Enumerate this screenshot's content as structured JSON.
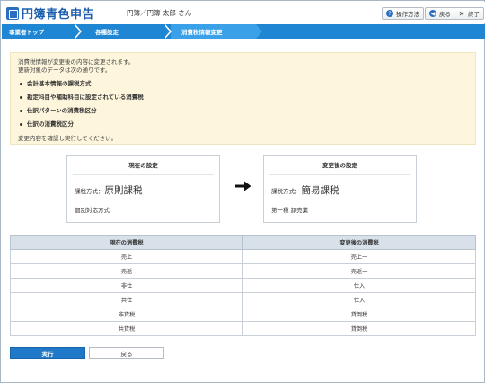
{
  "header": {
    "app_title": "円簿青色申告",
    "user_name": "円簿／円簿 太郎 さん",
    "help_label": "操作方法",
    "back_label": "戻る",
    "close_label": "終了"
  },
  "breadcrumb": {
    "items": [
      "事業者トップ",
      "各種設定",
      "消費税情報変更"
    ]
  },
  "notice": {
    "line1": "消費税情報が変更後の内容に変更されます。",
    "line2": "更新対象のデータは次の通りです。",
    "items": [
      "会計基本情報の課税方式",
      "勘定科目や補助科目に設定されている消費税",
      "仕訳パターンの消費税区分",
      "仕訳の消費税区分"
    ],
    "footer": "変更内容を確認し実行してください。"
  },
  "current": {
    "title": "現在の設定",
    "method_prefix": "課税方式：",
    "method_value": "原則課税",
    "detail": "個別対応方式"
  },
  "after": {
    "title": "変更後の設定",
    "method_prefix": "課税方式：",
    "method_value": "簡易課税",
    "detail": "第一種 卸売業"
  },
  "table": {
    "headers": [
      "現在の消費税",
      "変更後の消費税"
    ],
    "rows": [
      [
        "売上",
        "売上一"
      ],
      [
        "売返",
        "売返一"
      ],
      [
        "非仕",
        "仕入"
      ],
      [
        "共仕",
        "仕入"
      ],
      [
        "非貸税",
        "貸倒税"
      ],
      [
        "共貸税",
        "貸倒税"
      ]
    ]
  },
  "actions": {
    "execute_label": "実行",
    "back_label": "戻る"
  },
  "colors": {
    "brand": "#1d5fae",
    "breadcrumb": "#1f86d4",
    "notice_bg": "#fdf6dc",
    "primary_button": "#1f78c8"
  }
}
